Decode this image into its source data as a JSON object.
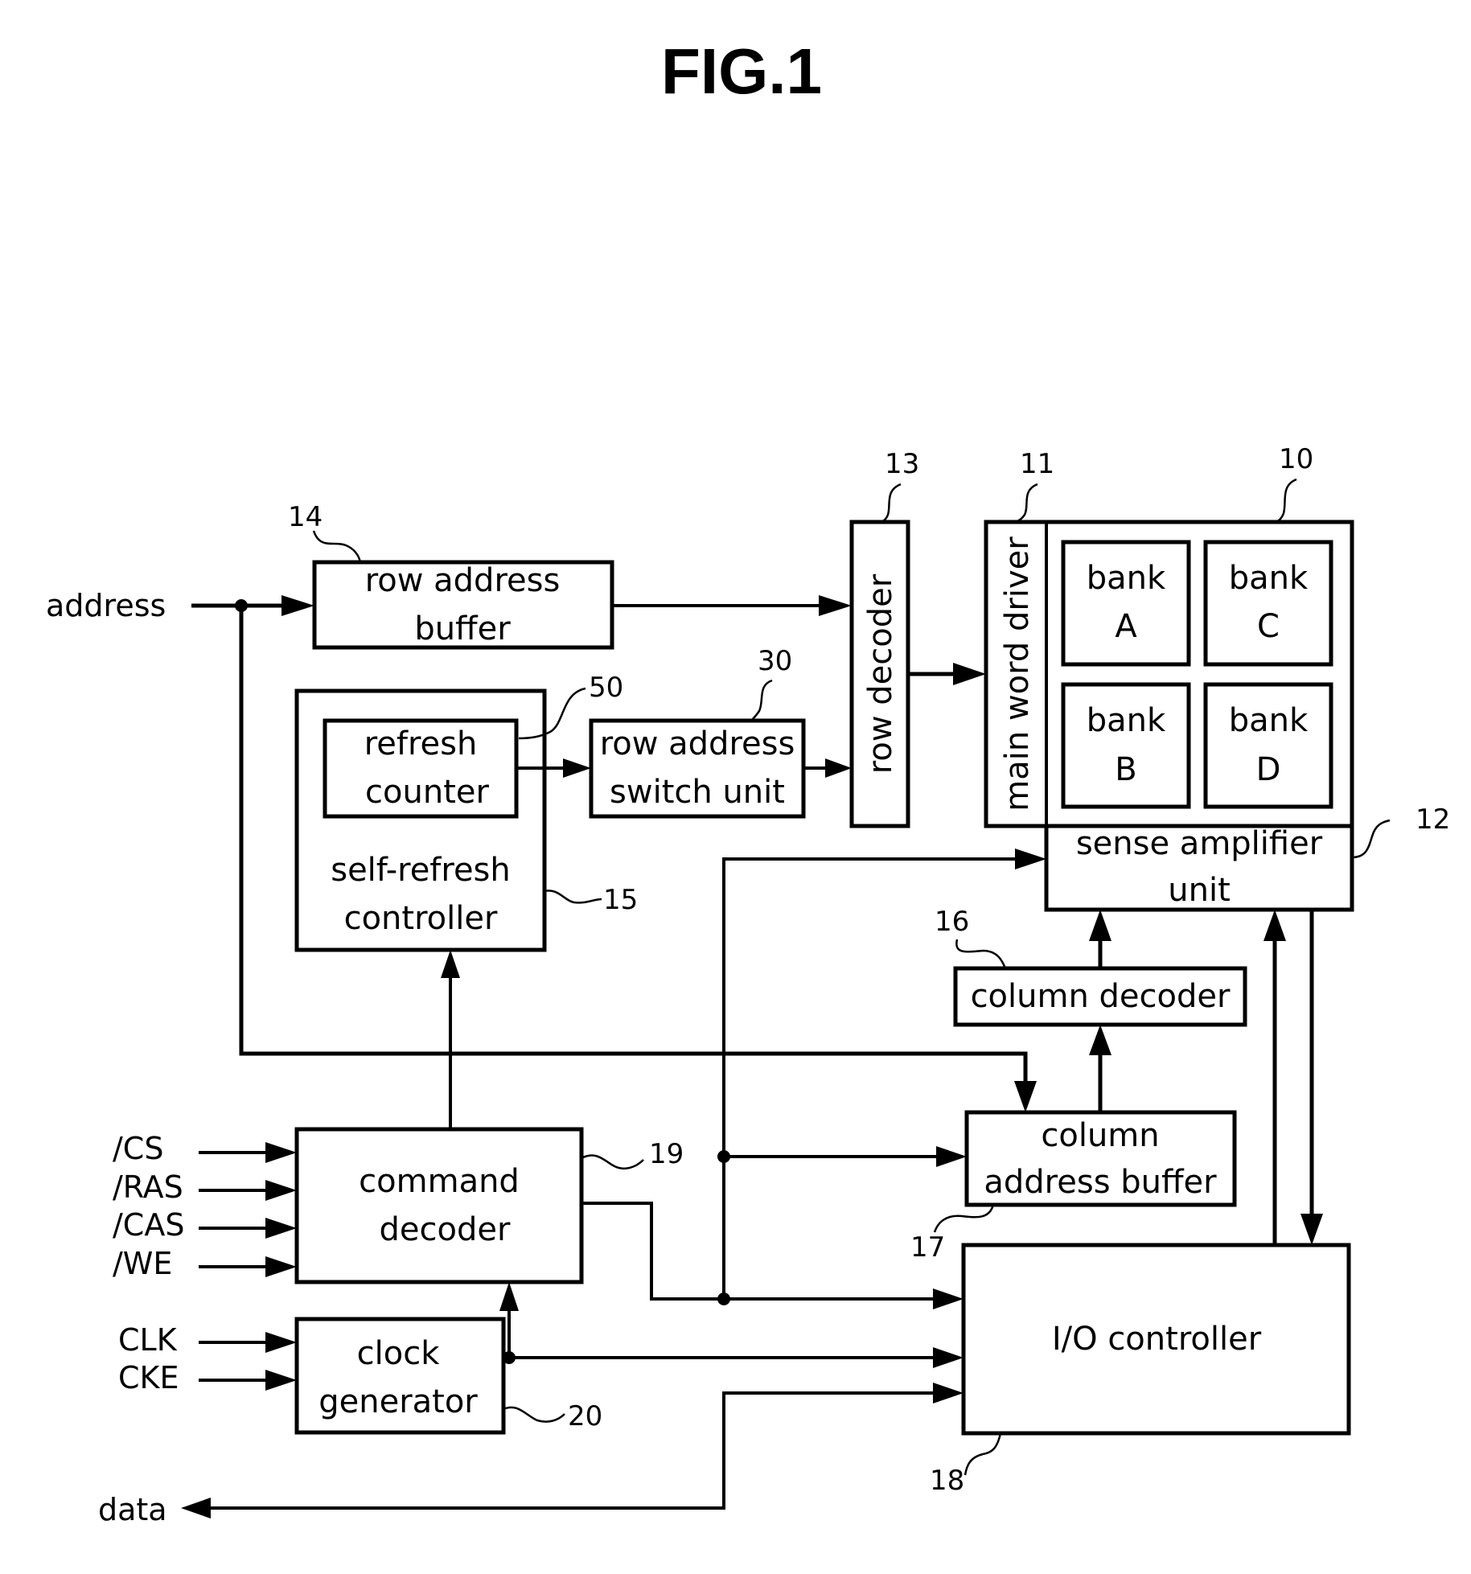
{
  "figure": {
    "title": "FIG.1"
  },
  "signals": {
    "address": "address",
    "cs": "/CS",
    "ras": "/RAS",
    "cas": "/CAS",
    "we": "/WE",
    "clk": "CLK",
    "cke": "CKE",
    "data": "data"
  },
  "blocks": {
    "row_address_buffer": {
      "line1": "row address",
      "line2": "buffer",
      "ref": "14"
    },
    "row_decoder": {
      "label": "row decoder",
      "ref": "13"
    },
    "main_word_driver": {
      "label": "main word driver",
      "ref": "11"
    },
    "memory_array": {
      "ref": "10",
      "banks": [
        {
          "line1": "bank",
          "line2": "A"
        },
        {
          "line1": "bank",
          "line2": "C"
        },
        {
          "line1": "bank",
          "line2": "B"
        },
        {
          "line1": "bank",
          "line2": "D"
        }
      ]
    },
    "sense_amplifier": {
      "line1": "sense amplifier",
      "line2": "unit",
      "ref": "12"
    },
    "self_refresh_controller": {
      "line1": "self-refresh",
      "line2": "controller",
      "ref": "15"
    },
    "refresh_counter": {
      "line1": "refresh",
      "line2": "counter",
      "ref": "50"
    },
    "row_address_switch": {
      "line1": "row address",
      "line2": "switch unit",
      "ref": "30"
    },
    "column_decoder": {
      "label": "column decoder",
      "ref": "16"
    },
    "column_address_buffer": {
      "line1": "column",
      "line2": "address buffer",
      "ref": "17"
    },
    "command_decoder": {
      "line1": "command",
      "line2": "decoder",
      "ref": "19"
    },
    "clock_generator": {
      "line1": "clock",
      "line2": "generator",
      "ref": "20"
    },
    "io_controller": {
      "label": "I/O controller",
      "ref": "18"
    }
  }
}
